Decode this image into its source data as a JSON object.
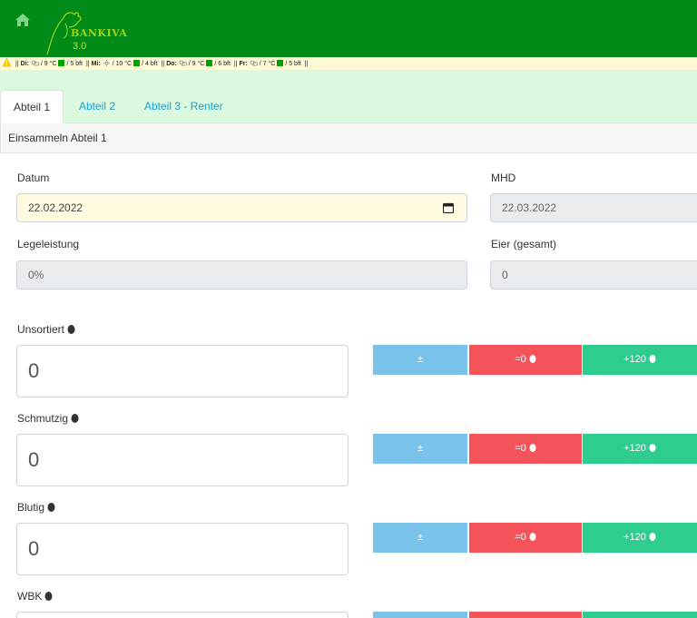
{
  "navbar": {
    "brand_name": "BANKIVA",
    "version": "3.0"
  },
  "weather": {
    "segments": [
      {
        "day": "Di:",
        "temp": "9 °C",
        "wind": "5 bft"
      },
      {
        "day": "Mi:",
        "temp": "10 °C",
        "wind": "4 bft"
      },
      {
        "day": "Do:",
        "temp": "9 °C",
        "wind": "6 bft"
      },
      {
        "day": "Fr:",
        "temp": "7 °C",
        "wind": "5 bft"
      }
    ]
  },
  "tabs": {
    "tab1": "Abteil 1",
    "tab2": "Abteil 2",
    "tab3": "Abteil 3 - Renter"
  },
  "card": {
    "header": "Einsammeln Abteil 1"
  },
  "form": {
    "datum_label": "Datum",
    "datum_value": "22.02.2022",
    "mhd_label": "MHD",
    "mhd_value": "22.03.2022",
    "legeleistung_label": "Legeleistung",
    "legeleistung_value": "0%",
    "eier_label": "Eier (gesamt)",
    "eier_value": "0"
  },
  "counters": {
    "unsortiert": {
      "label": "Unsortiert",
      "value": "0"
    },
    "schmutzig": {
      "label": "Schmutzig",
      "value": "0"
    },
    "blutig": {
      "label": "Blutig",
      "value": "0"
    },
    "wbk": {
      "label": "WBK",
      "value": ""
    }
  },
  "buttons": {
    "plusminus": "±",
    "zero": "=0",
    "plus120": "+120"
  },
  "colors": {
    "navbar": "#008a18",
    "tabbar": "#dbf9df",
    "btn_pm": "#79c3ea",
    "btn_zero": "#f5535a",
    "btn_plus": "#2ecc8e"
  }
}
